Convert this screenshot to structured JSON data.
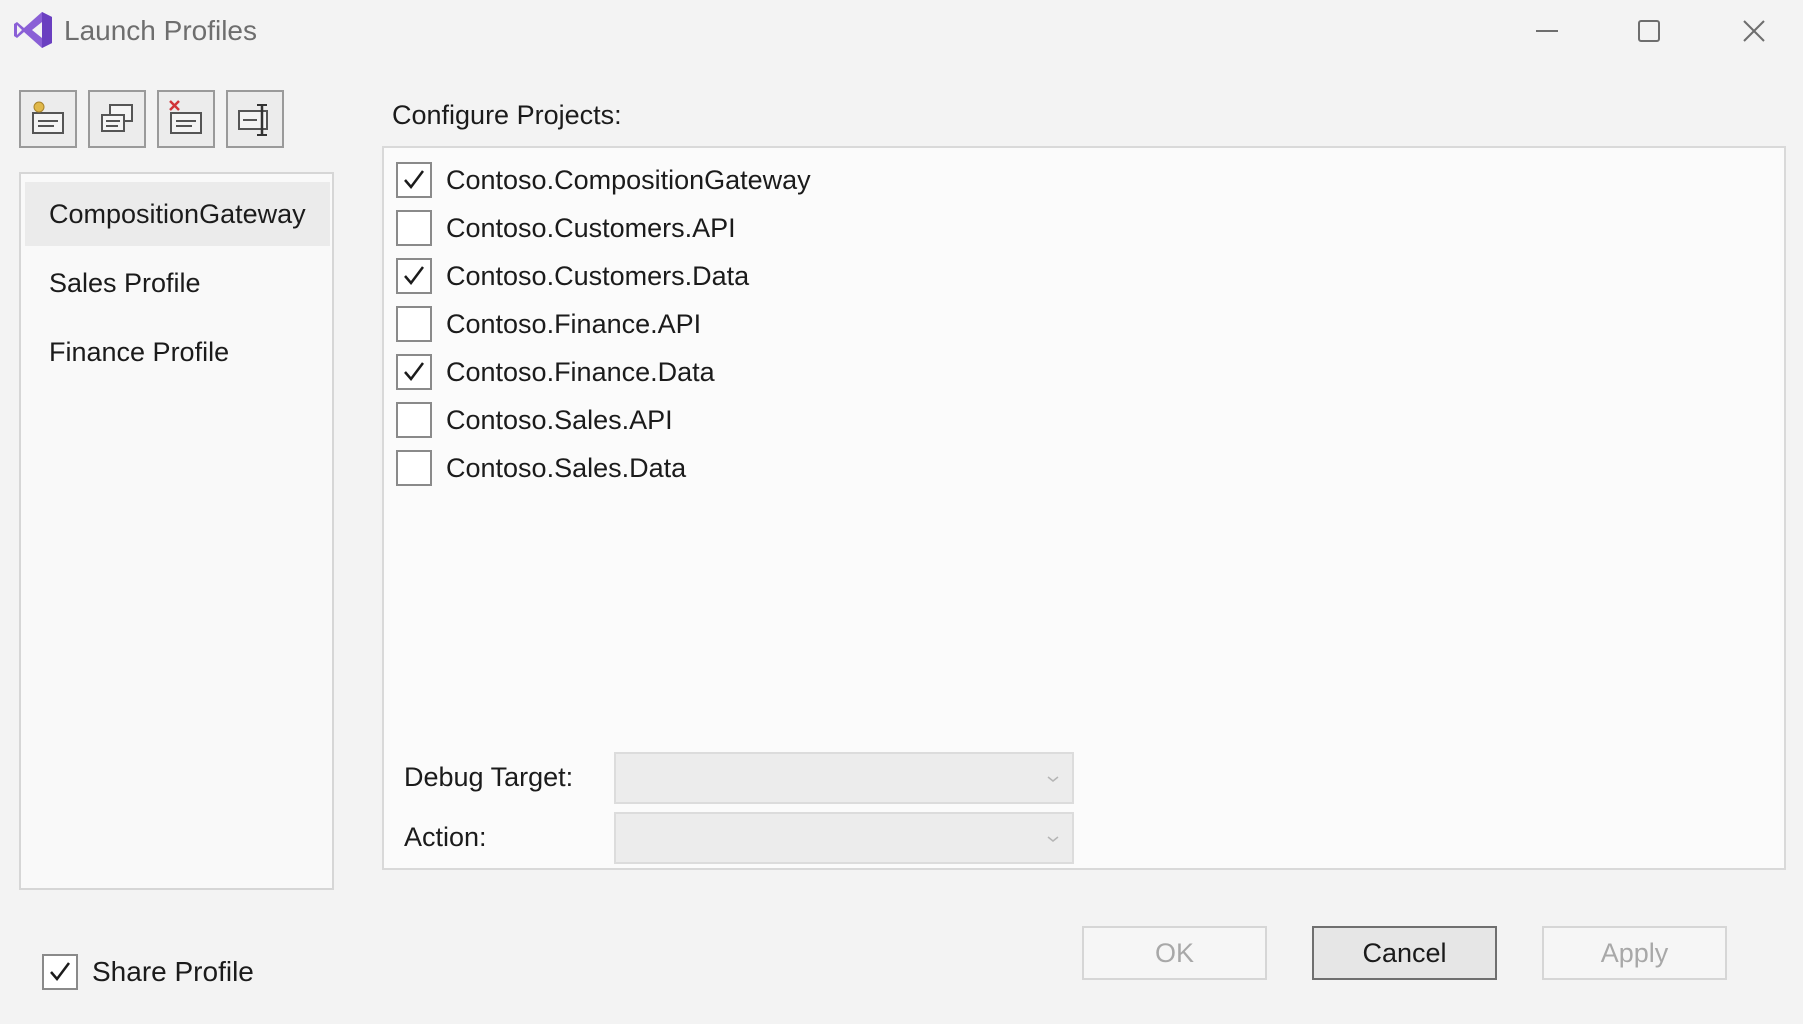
{
  "window": {
    "title": "Launch Profiles",
    "icon": "visual-studio-logo-icon"
  },
  "window_controls": {
    "minimize_icon": "minimize-icon",
    "maximize_icon": "maximize-icon",
    "close_icon": "close-icon"
  },
  "toolbar": {
    "buttons": [
      {
        "icon": "add-profile-icon"
      },
      {
        "icon": "duplicate-profile-icon"
      },
      {
        "icon": "delete-profile-icon"
      },
      {
        "icon": "rename-profile-icon"
      }
    ]
  },
  "profiles": {
    "items": [
      {
        "label": "CompositionGateway",
        "selected": true
      },
      {
        "label": "Sales Profile",
        "selected": false
      },
      {
        "label": "Finance Profile",
        "selected": false
      }
    ]
  },
  "projects": {
    "label": "Configure Projects:",
    "items": [
      {
        "label": "Contoso.CompositionGateway",
        "checked": true
      },
      {
        "label": "Contoso.Customers.API",
        "checked": false
      },
      {
        "label": "Contoso.Customers.Data",
        "checked": true
      },
      {
        "label": "Contoso.Finance.API",
        "checked": false
      },
      {
        "label": "Contoso.Finance.Data",
        "checked": true
      },
      {
        "label": "Contoso.Sales.API",
        "checked": false
      },
      {
        "label": "Contoso.Sales.Data",
        "checked": false
      }
    ],
    "debug_target": {
      "label": "Debug Target:",
      "value": ""
    },
    "action": {
      "label": "Action:",
      "value": ""
    }
  },
  "share_profile": {
    "label": "Share Profile",
    "checked": true
  },
  "buttons": {
    "ok": "OK",
    "cancel": "Cancel",
    "apply": "Apply"
  },
  "colors": {
    "logo_purple": "#7c4dcc",
    "selected_bg": "#ebebeb",
    "disabled_text": "#a8a8a8"
  }
}
